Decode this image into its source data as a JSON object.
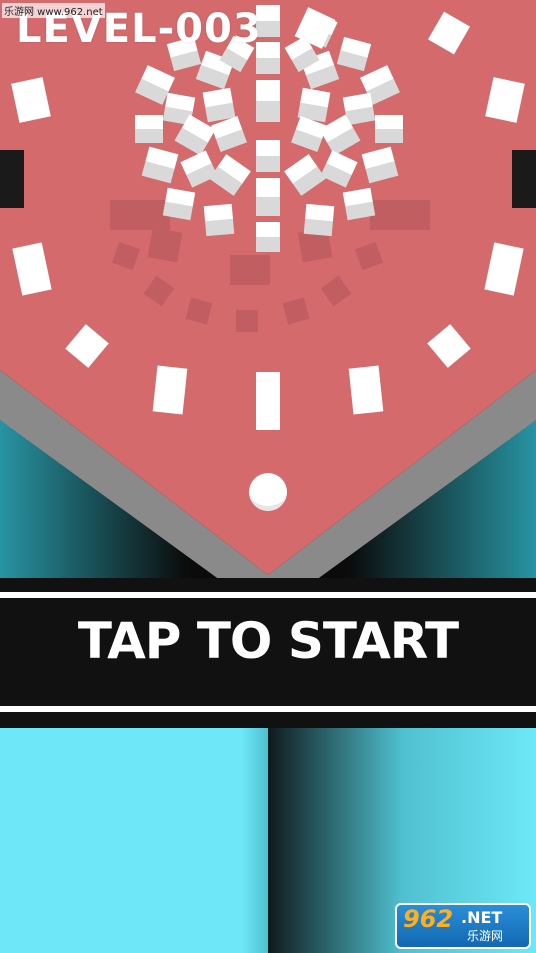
{
  "hud": {
    "level_label": "LEVEL-003"
  },
  "banner": {
    "prompt": "TAP TO START"
  },
  "watermark": {
    "top_text": "乐游网 www.962.net",
    "logo_main": "962",
    "logo_net": ".NET",
    "logo_cn": "乐游网"
  },
  "colors": {
    "board": "#d46a6c",
    "board_shadow": "#c05e61",
    "rail": "#8a8a8a",
    "cube_top": "#ffffff",
    "cube_side": "#d9d9d9",
    "floor_cyan": "#6ee8f8",
    "banner": "#111111"
  }
}
